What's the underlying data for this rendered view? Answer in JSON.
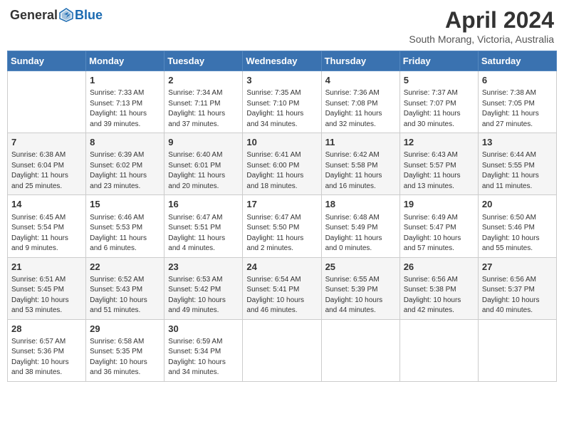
{
  "header": {
    "logo_general": "General",
    "logo_blue": "Blue",
    "month_title": "April 2024",
    "location": "South Morang, Victoria, Australia"
  },
  "days_of_week": [
    "Sunday",
    "Monday",
    "Tuesday",
    "Wednesday",
    "Thursday",
    "Friday",
    "Saturday"
  ],
  "weeks": [
    [
      {
        "day": "",
        "sunrise": "",
        "sunset": "",
        "daylight": ""
      },
      {
        "day": "1",
        "sunrise": "Sunrise: 7:33 AM",
        "sunset": "Sunset: 7:13 PM",
        "daylight": "Daylight: 11 hours and 39 minutes."
      },
      {
        "day": "2",
        "sunrise": "Sunrise: 7:34 AM",
        "sunset": "Sunset: 7:11 PM",
        "daylight": "Daylight: 11 hours and 37 minutes."
      },
      {
        "day": "3",
        "sunrise": "Sunrise: 7:35 AM",
        "sunset": "Sunset: 7:10 PM",
        "daylight": "Daylight: 11 hours and 34 minutes."
      },
      {
        "day": "4",
        "sunrise": "Sunrise: 7:36 AM",
        "sunset": "Sunset: 7:08 PM",
        "daylight": "Daylight: 11 hours and 32 minutes."
      },
      {
        "day": "5",
        "sunrise": "Sunrise: 7:37 AM",
        "sunset": "Sunset: 7:07 PM",
        "daylight": "Daylight: 11 hours and 30 minutes."
      },
      {
        "day": "6",
        "sunrise": "Sunrise: 7:38 AM",
        "sunset": "Sunset: 7:05 PM",
        "daylight": "Daylight: 11 hours and 27 minutes."
      }
    ],
    [
      {
        "day": "7",
        "sunrise": "Sunrise: 6:38 AM",
        "sunset": "Sunset: 6:04 PM",
        "daylight": "Daylight: 11 hours and 25 minutes."
      },
      {
        "day": "8",
        "sunrise": "Sunrise: 6:39 AM",
        "sunset": "Sunset: 6:02 PM",
        "daylight": "Daylight: 11 hours and 23 minutes."
      },
      {
        "day": "9",
        "sunrise": "Sunrise: 6:40 AM",
        "sunset": "Sunset: 6:01 PM",
        "daylight": "Daylight: 11 hours and 20 minutes."
      },
      {
        "day": "10",
        "sunrise": "Sunrise: 6:41 AM",
        "sunset": "Sunset: 6:00 PM",
        "daylight": "Daylight: 11 hours and 18 minutes."
      },
      {
        "day": "11",
        "sunrise": "Sunrise: 6:42 AM",
        "sunset": "Sunset: 5:58 PM",
        "daylight": "Daylight: 11 hours and 16 minutes."
      },
      {
        "day": "12",
        "sunrise": "Sunrise: 6:43 AM",
        "sunset": "Sunset: 5:57 PM",
        "daylight": "Daylight: 11 hours and 13 minutes."
      },
      {
        "day": "13",
        "sunrise": "Sunrise: 6:44 AM",
        "sunset": "Sunset: 5:55 PM",
        "daylight": "Daylight: 11 hours and 11 minutes."
      }
    ],
    [
      {
        "day": "14",
        "sunrise": "Sunrise: 6:45 AM",
        "sunset": "Sunset: 5:54 PM",
        "daylight": "Daylight: 11 hours and 9 minutes."
      },
      {
        "day": "15",
        "sunrise": "Sunrise: 6:46 AM",
        "sunset": "Sunset: 5:53 PM",
        "daylight": "Daylight: 11 hours and 6 minutes."
      },
      {
        "day": "16",
        "sunrise": "Sunrise: 6:47 AM",
        "sunset": "Sunset: 5:51 PM",
        "daylight": "Daylight: 11 hours and 4 minutes."
      },
      {
        "day": "17",
        "sunrise": "Sunrise: 6:47 AM",
        "sunset": "Sunset: 5:50 PM",
        "daylight": "Daylight: 11 hours and 2 minutes."
      },
      {
        "day": "18",
        "sunrise": "Sunrise: 6:48 AM",
        "sunset": "Sunset: 5:49 PM",
        "daylight": "Daylight: 11 hours and 0 minutes."
      },
      {
        "day": "19",
        "sunrise": "Sunrise: 6:49 AM",
        "sunset": "Sunset: 5:47 PM",
        "daylight": "Daylight: 10 hours and 57 minutes."
      },
      {
        "day": "20",
        "sunrise": "Sunrise: 6:50 AM",
        "sunset": "Sunset: 5:46 PM",
        "daylight": "Daylight: 10 hours and 55 minutes."
      }
    ],
    [
      {
        "day": "21",
        "sunrise": "Sunrise: 6:51 AM",
        "sunset": "Sunset: 5:45 PM",
        "daylight": "Daylight: 10 hours and 53 minutes."
      },
      {
        "day": "22",
        "sunrise": "Sunrise: 6:52 AM",
        "sunset": "Sunset: 5:43 PM",
        "daylight": "Daylight: 10 hours and 51 minutes."
      },
      {
        "day": "23",
        "sunrise": "Sunrise: 6:53 AM",
        "sunset": "Sunset: 5:42 PM",
        "daylight": "Daylight: 10 hours and 49 minutes."
      },
      {
        "day": "24",
        "sunrise": "Sunrise: 6:54 AM",
        "sunset": "Sunset: 5:41 PM",
        "daylight": "Daylight: 10 hours and 46 minutes."
      },
      {
        "day": "25",
        "sunrise": "Sunrise: 6:55 AM",
        "sunset": "Sunset: 5:39 PM",
        "daylight": "Daylight: 10 hours and 44 minutes."
      },
      {
        "day": "26",
        "sunrise": "Sunrise: 6:56 AM",
        "sunset": "Sunset: 5:38 PM",
        "daylight": "Daylight: 10 hours and 42 minutes."
      },
      {
        "day": "27",
        "sunrise": "Sunrise: 6:56 AM",
        "sunset": "Sunset: 5:37 PM",
        "daylight": "Daylight: 10 hours and 40 minutes."
      }
    ],
    [
      {
        "day": "28",
        "sunrise": "Sunrise: 6:57 AM",
        "sunset": "Sunset: 5:36 PM",
        "daylight": "Daylight: 10 hours and 38 minutes."
      },
      {
        "day": "29",
        "sunrise": "Sunrise: 6:58 AM",
        "sunset": "Sunset: 5:35 PM",
        "daylight": "Daylight: 10 hours and 36 minutes."
      },
      {
        "day": "30",
        "sunrise": "Sunrise: 6:59 AM",
        "sunset": "Sunset: 5:34 PM",
        "daylight": "Daylight: 10 hours and 34 minutes."
      },
      {
        "day": "",
        "sunrise": "",
        "sunset": "",
        "daylight": ""
      },
      {
        "day": "",
        "sunrise": "",
        "sunset": "",
        "daylight": ""
      },
      {
        "day": "",
        "sunrise": "",
        "sunset": "",
        "daylight": ""
      },
      {
        "day": "",
        "sunrise": "",
        "sunset": "",
        "daylight": ""
      }
    ]
  ]
}
